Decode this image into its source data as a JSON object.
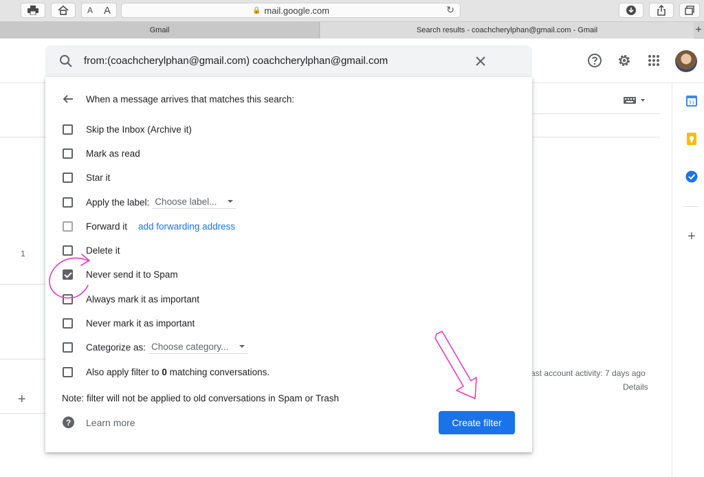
{
  "browser": {
    "address": "mail.google.com",
    "text_size_small": "A",
    "text_size_large": "A",
    "tabs": [
      {
        "label": "Gmail"
      },
      {
        "label": "Search results - coachcherylphan@gmail.com - Gmail"
      }
    ],
    "new_tab": "+"
  },
  "search": {
    "query": "from:(coachcherylphan@gmail.com) coachcherylphan@gmail.com"
  },
  "filter": {
    "heading": "When a message arrives that matches this search:",
    "options": [
      {
        "label": "Skip the Inbox (Archive it)",
        "checked": false
      },
      {
        "label": "Mark as read",
        "checked": false
      },
      {
        "label": "Star it",
        "checked": false
      },
      {
        "label": "Apply the label:",
        "checked": false,
        "select": "Choose label..."
      },
      {
        "label": "Forward it",
        "checked": false,
        "link": "add forwarding address"
      },
      {
        "label": "Delete it",
        "checked": false
      },
      {
        "label": "Never send it to Spam",
        "checked": true
      },
      {
        "label": "Always mark it as important",
        "checked": false
      },
      {
        "label": "Never mark it as important",
        "checked": false
      },
      {
        "label": "Categorize as:",
        "checked": false,
        "select": "Choose category..."
      },
      {
        "label_pre": "Also apply filter to ",
        "count": "0",
        "label_post": " matching conversations.",
        "checked": false
      }
    ],
    "note": "Note: filter will not be applied to old conversations in Spam or Trash",
    "learn_more": "Learn more",
    "create_button": "Create filter"
  },
  "background": {
    "left_count": "1",
    "left_plus": "+",
    "activity": "ast account activity: 7 days ago",
    "details": "Details",
    "side_plus": "+"
  },
  "colors": {
    "primary": "#1a73e8",
    "annotation": "#e83bbf"
  }
}
